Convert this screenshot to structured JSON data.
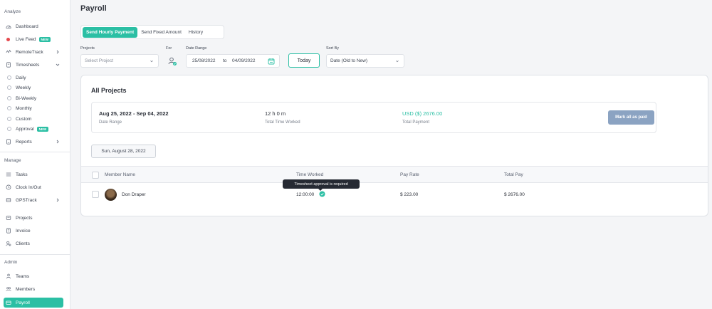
{
  "page_title": "Payroll",
  "sidebar": {
    "analyze_title": "Analyze",
    "manage_title": "Manage",
    "admin_title": "Admin",
    "new_badge": "NEW",
    "items": {
      "dashboard": "Dashboard",
      "live_feed": "Live Feed",
      "remotetrack": "RemoteTrack",
      "timesheets": "Timesheets",
      "daily": "Daily",
      "weekly": "Weekly",
      "biweekly": "Bi-Weekly",
      "monthly": "Monthly",
      "custom": "Custom",
      "approval": "Approval",
      "reports": "Reports",
      "tasks": "Tasks",
      "clock": "Clock In/Out",
      "gpstrack": "GPSTrack",
      "projects": "Projects",
      "invoice": "Invoice",
      "clients": "Clients",
      "teams": "Teams",
      "members": "Members",
      "payroll": "Payroll"
    }
  },
  "tabs": {
    "hourly": "Send Hourly Payment",
    "fixed": "Send Fixed Amount",
    "history": "History"
  },
  "filters": {
    "projects_label": "Projects",
    "projects_placeholder": "Select Project",
    "for_label": "For",
    "date_range_label": "Date Range",
    "date_from": "25/08/2022",
    "date_to_word": "to",
    "date_to": "04/09/2022",
    "today": "Today",
    "sort_label": "Sort By",
    "sort_value": "Date (Old to New)"
  },
  "card": {
    "title": "All Projects",
    "period": "Aug 25, 2022 - Sep 04, 2022",
    "period_label": "Date Range",
    "total_time": "12 h 0 m",
    "total_time_label": "Total Time Worked",
    "total_payment": "USD ($) 2676.00",
    "total_payment_label": "Total Payment",
    "mark_all": "Mark all as paid",
    "date_chip": "Sun, August 28, 2022"
  },
  "table": {
    "headers": {
      "member": "Member Name",
      "time": "Time Worked",
      "rate": "Pay Rate",
      "total": "Total Pay"
    },
    "rows": [
      {
        "member": "Don Draper",
        "time": "12:00:00",
        "rate": "$ 223.00",
        "total": "$ 2676.00"
      }
    ]
  },
  "tooltip": "Timesheet approval is required",
  "colors": {
    "accent": "#2bbfa4",
    "button_muted": "#8ba3c2",
    "tooltip_bg": "#262a33"
  }
}
